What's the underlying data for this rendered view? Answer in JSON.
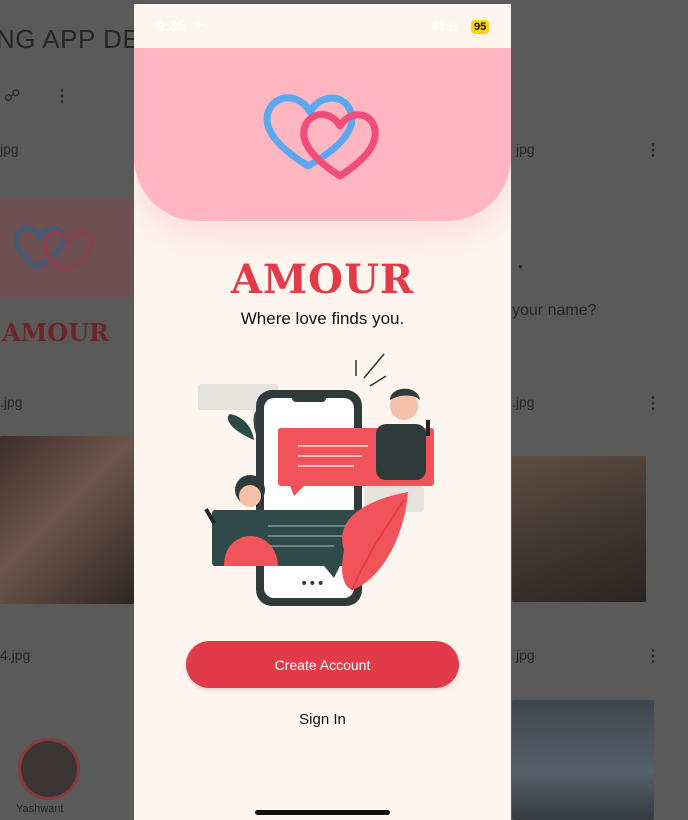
{
  "background": {
    "title": "NG APP DE...",
    "files": [
      "jpg",
      "jpg",
      ".jpg",
      ".jpg",
      "4.jpg",
      "jpg"
    ],
    "brand_mini": "AMOUR",
    "question": "your name?",
    "avatar_name": "Yashwant"
  },
  "status_bar": {
    "time": "9:35",
    "battery": "95"
  },
  "app": {
    "brand": "AMOUR",
    "tagline": "Where love finds you.",
    "create_account": "Create Account",
    "sign_in": "Sign In"
  },
  "colors": {
    "accent": "#e23a48",
    "hero": "#ffb6c0",
    "background": "#fdf6ee",
    "heart_blue": "#5aa8f0",
    "heart_pink": "#f04d7a"
  }
}
